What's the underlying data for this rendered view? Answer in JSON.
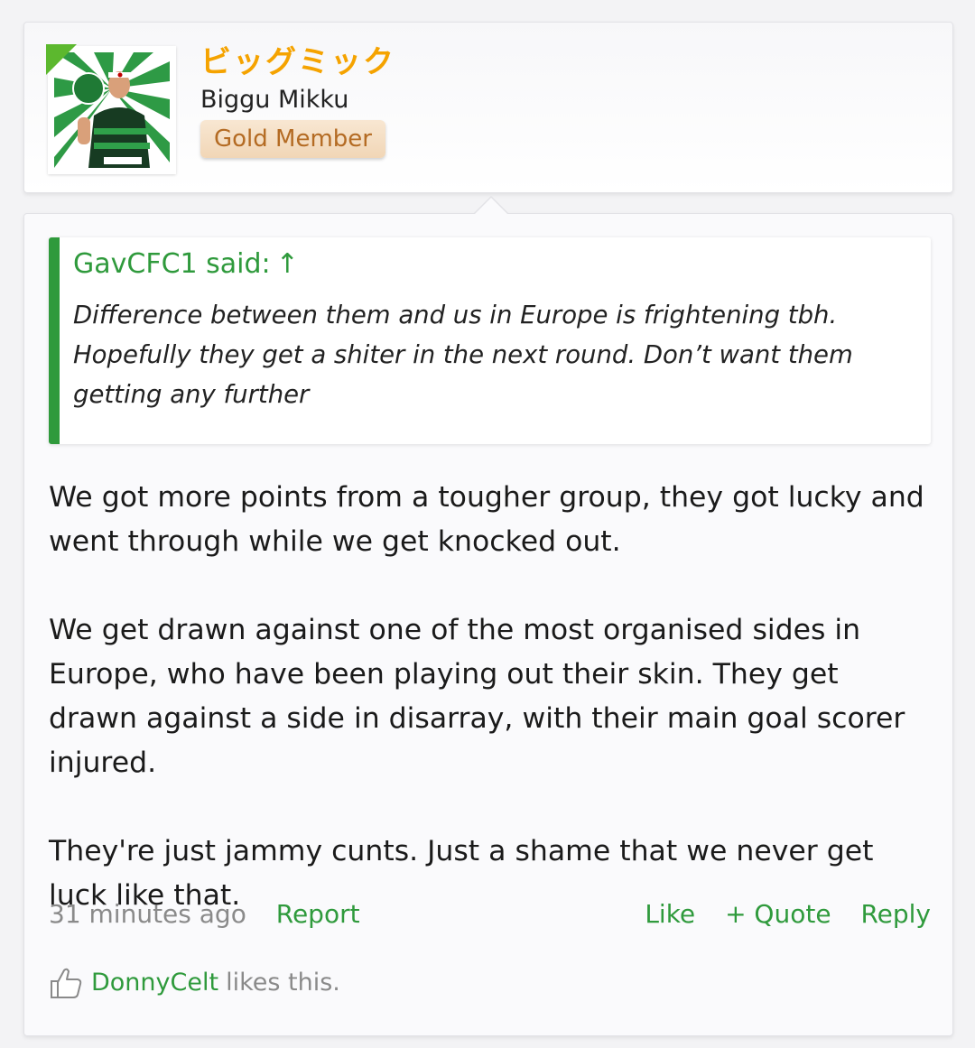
{
  "user": {
    "display_name_jp": "ビッグミック",
    "display_name_en": "Biggu Mikku",
    "badge": "Gold Member",
    "avatar_icon": "user-avatar-image"
  },
  "post": {
    "quote": {
      "author_line": "GavCFC1 said:",
      "arrow": "↑",
      "lines": [
        "Difference between them and us in Europe is frightening tbh.",
        "Hopefully they get a shiter in the next round. Don’t want them",
        "getting any further"
      ]
    },
    "paragraphs": [
      "We got more points from a tougher group, they got lucky and went through while we get knocked out.",
      "We get drawn against one of the most organised sides in Europe, who have been playing out their skin. They get drawn against a side in disarray, with their main goal scorer injured.",
      "They're just jammy cunts. Just a shame that we never get luck like that."
    ],
    "timestamp": "31 minutes ago",
    "report_label": "Report",
    "like_label": "Like",
    "quote_label": "+ Quote",
    "reply_label": "Reply",
    "liked_by": "DonnyCelt",
    "likes_suffix": "likes this."
  },
  "colors": {
    "accent_green": "#2f9a3c",
    "name_orange": "#f5a300",
    "badge_text": "#b46b23"
  }
}
